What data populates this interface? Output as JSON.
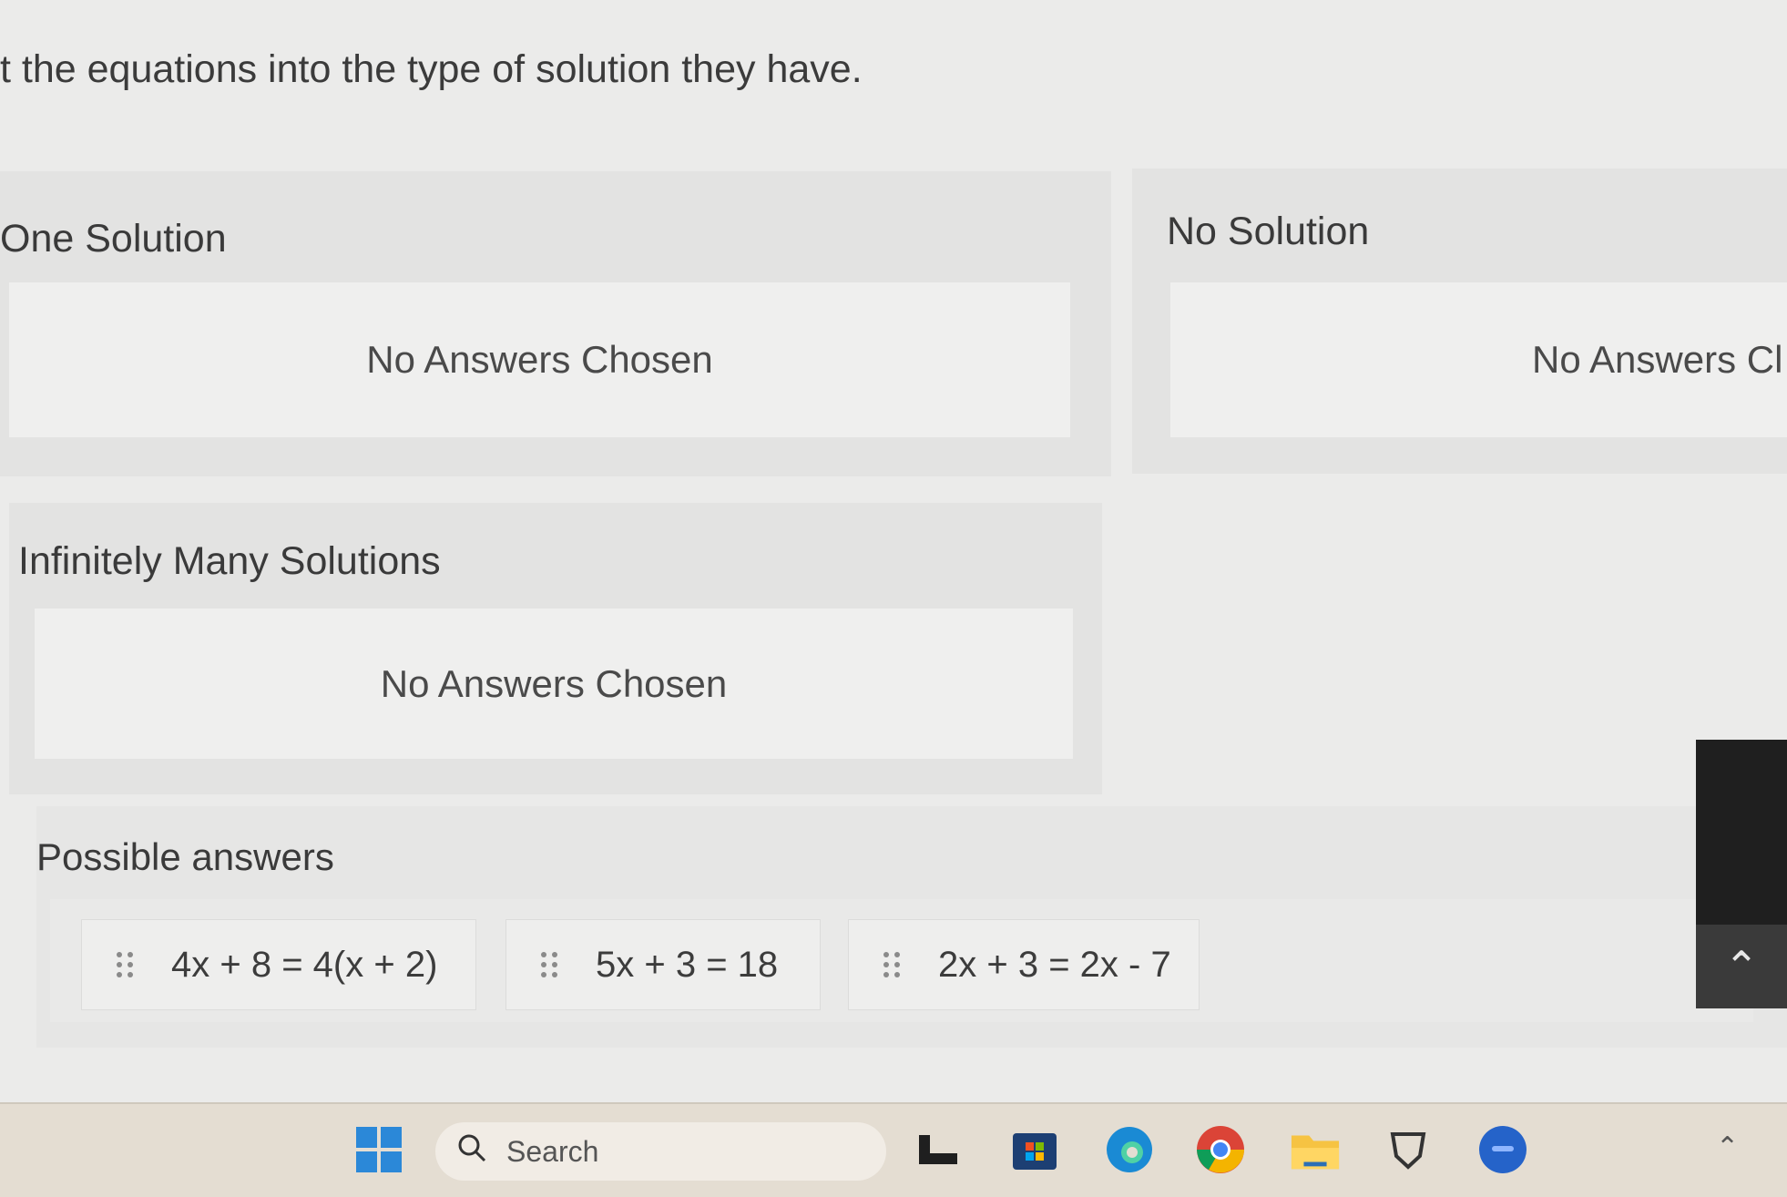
{
  "instruction": "t the equations into the type of solution they have.",
  "categories": [
    {
      "title": "One Solution",
      "empty_text": "No Answers Chosen"
    },
    {
      "title": "No Solution",
      "empty_text": "No Answers Cl"
    },
    {
      "title": "Infinitely Many Solutions",
      "empty_text": "No Answers Chosen"
    }
  ],
  "possible_answers": {
    "title": "Possible answers",
    "items": [
      "4x + 8 = 4(x + 2)",
      "5x + 3 = 18",
      "2x + 3 = 2x - 7"
    ]
  },
  "taskbar": {
    "search_placeholder": "Search",
    "icons": [
      "windows-start-icon",
      "search-icon",
      "terminal-icon",
      "store-icon",
      "edge-icon",
      "chrome-icon",
      "file-explorer-icon",
      "vpn-shield-icon",
      "app-icon",
      "tray-chevron-icon"
    ]
  },
  "colors": {
    "page_bg": "#ebebea",
    "panel_bg": "#e3e3e2",
    "dropzone_bg": "#efefee",
    "taskbar_bg": "#e4ddd2"
  }
}
